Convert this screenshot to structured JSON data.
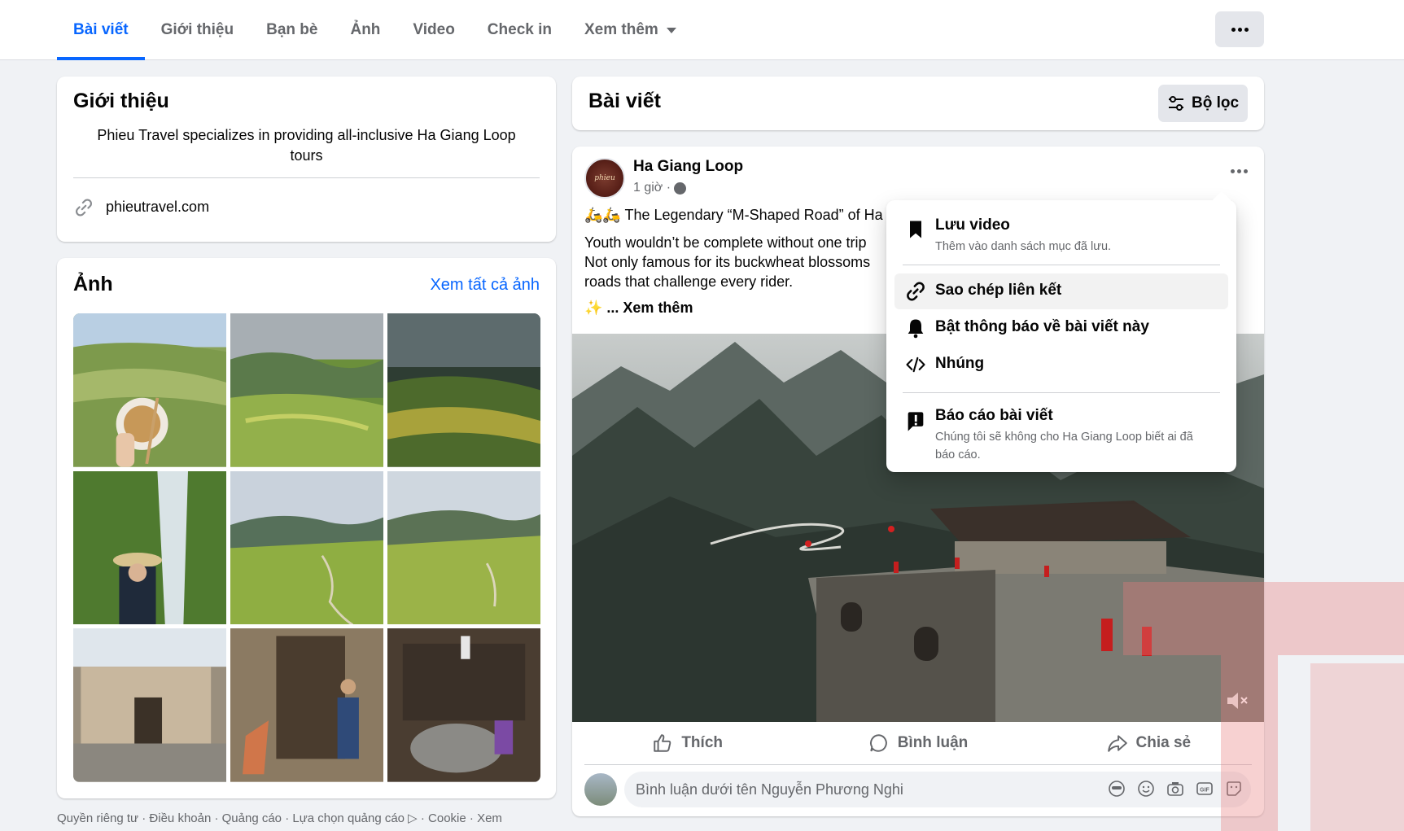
{
  "tabs": [
    {
      "label": "Bài viết",
      "active": true
    },
    {
      "label": "Giới thiệu"
    },
    {
      "label": "Bạn bè"
    },
    {
      "label": "Ảnh"
    },
    {
      "label": "Video"
    },
    {
      "label": "Check in"
    },
    {
      "label": "Xem thêm"
    }
  ],
  "intro": {
    "title": "Giới thiệu",
    "bio": "Phieu Travel specializes in providing all-inclusive Ha Giang Loop tours",
    "website": "phieutravel.com"
  },
  "photos": {
    "title": "Ảnh",
    "see_all": "Xem tất cả ảnh"
  },
  "footer": "Quyền riêng tư · Điều khoản · Quảng cáo · Lựa chọn quảng cáo ▷ · Cookie · Xem",
  "posts_header": {
    "title": "Bài viết",
    "filter_label": "Bộ lọc"
  },
  "post": {
    "author": "Ha Giang Loop",
    "time": "1 giờ ·",
    "line1": "🛵🛵 The Legendary “M-Shaped Road” of Ha",
    "line2": "Youth wouldn’t be complete without one trip",
    "line3": "Not only famous for its buckwheat blossoms",
    "line4": "roads that challenge every rider.",
    "see_more": "✨ ... Xem thêm",
    "actions": {
      "like": "Thích",
      "comment": "Bình luận",
      "share": "Chia sẻ"
    },
    "comment_placeholder": "Bình luận dưới tên Nguyễn Phương Nghi"
  },
  "menu": {
    "save_label": "Lưu video",
    "save_sub": "Thêm vào danh sách mục đã lưu.",
    "copy_link": "Sao chép liên kết",
    "notify": "Bật thông báo về bài viết này",
    "embed": "Nhúng",
    "report_label": "Báo cáo bài viết",
    "report_sub": "Chúng tôi sẽ không cho Ha Giang Loop biết ai đã báo cáo."
  },
  "colors": {
    "accent": "#0866ff",
    "bg": "#f0f2f5",
    "muted": "#65676b"
  }
}
